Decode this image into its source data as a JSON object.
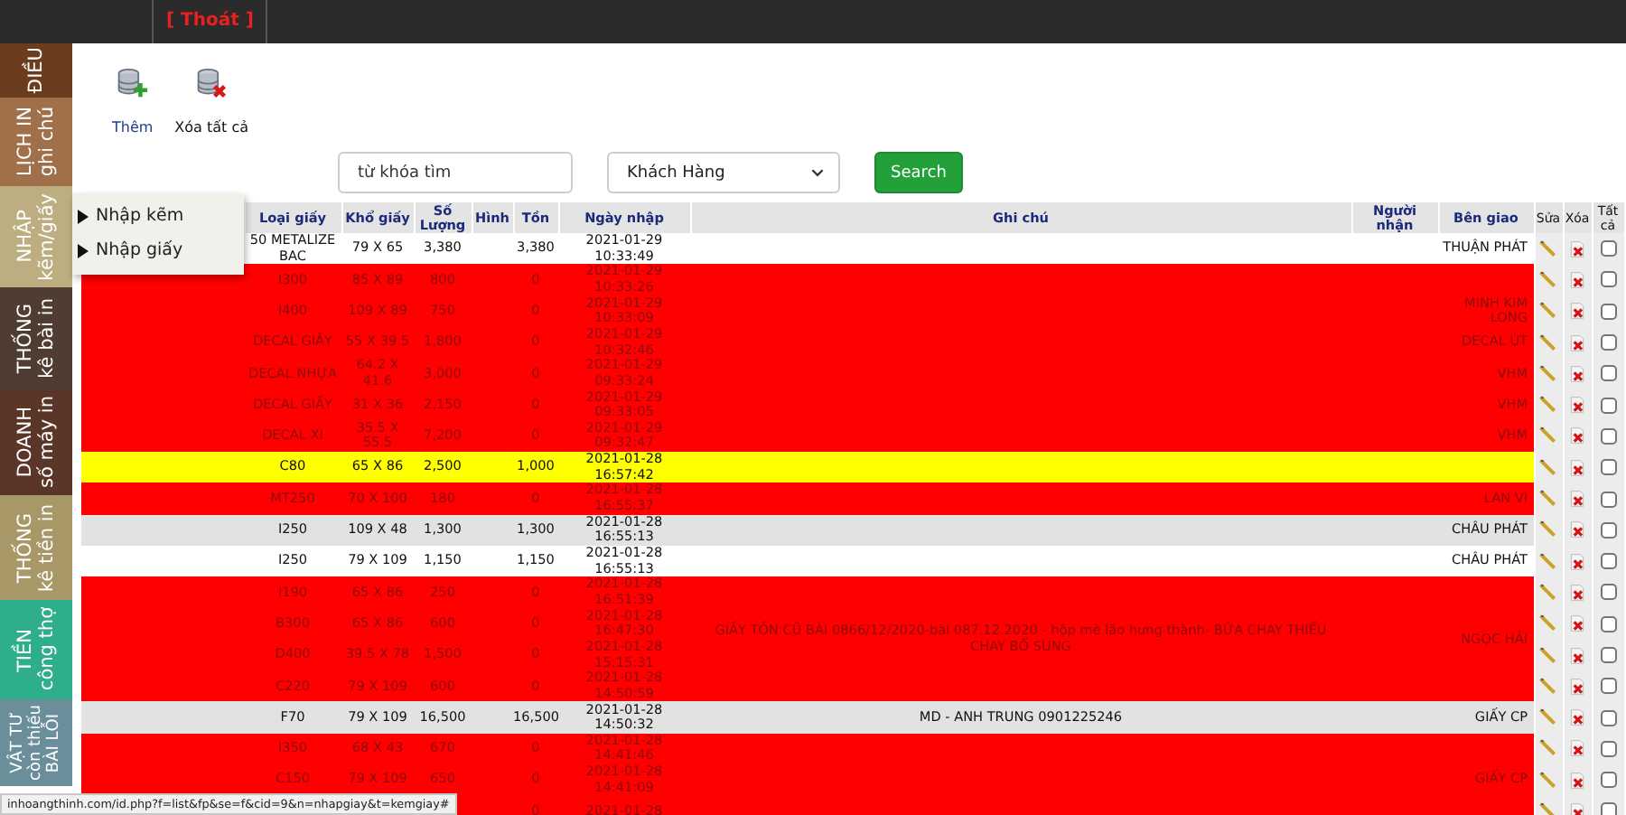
{
  "top_bar": {
    "logout": "[ Thoát ]"
  },
  "sidebar": {
    "tabs": [
      {
        "lines": [
          "ĐIỀU"
        ],
        "color": "#6b3d1e"
      },
      {
        "lines": [
          "LỊCH IN",
          "ghi chú"
        ],
        "color": "#a0704a"
      },
      {
        "lines": [
          "NHẬP",
          "kẽm/giấy"
        ],
        "color": "#bcae80"
      },
      {
        "lines": [
          "THỐNG",
          "kê bài in"
        ],
        "color": "#4f3d31"
      },
      {
        "lines": [
          "DOANH",
          "số máy in"
        ],
        "color": "#5a3628"
      },
      {
        "lines": [
          "THỐNG",
          "kê tiền in"
        ],
        "color": "#a89868"
      },
      {
        "lines": [
          "TIỀN",
          "công thợ"
        ],
        "color": "#2fae8c"
      },
      {
        "lines": [
          "VẬT TƯ",
          "còn thiếu",
          "BÀI LỖI"
        ],
        "color": "#6b8e9b"
      }
    ]
  },
  "popup_menu": {
    "items": [
      "Nhập kẽm",
      "Nhập giấy"
    ]
  },
  "toolbar": {
    "buttons": [
      {
        "label": "Thêm",
        "kind": "add"
      },
      {
        "label": "Xóa tất cả",
        "kind": "delete"
      }
    ]
  },
  "search": {
    "placeholder": "từ khóa tìm",
    "filter": "Khách Hàng",
    "button": "Search"
  },
  "table": {
    "columns": [
      "Loại giấy",
      "Khổ giấy",
      "Số Lượng",
      "Hình",
      "Tồn",
      "Ngày nhập",
      "Ghi chú",
      "Người nhận",
      "Bên giao",
      "Sửa",
      "Xóa",
      "Tất cả"
    ],
    "groups": [
      {
        "giver": "THUẬN PHÁT",
        "rows": [
          {
            "paper": "50 METALIZE BAC",
            "size": "79 X 65",
            "qty": "3,380",
            "stock": "3,380",
            "date": "2021-01-29",
            "time": "10:33:49",
            "color": "#ffffff",
            "checked": false
          }
        ]
      },
      {
        "rows": [
          {
            "paper": "I300",
            "size": "85 X 89",
            "qty": "800",
            "stock": "0",
            "date": "2021-01-29",
            "time": "10:33:26",
            "color": "#ff0000",
            "checked": false
          }
        ]
      },
      {
        "giver": "MINH KIM LONG",
        "rows": [
          {
            "paper": "I400",
            "size": "109 X 89",
            "qty": "750",
            "stock": "0",
            "date": "2021-01-29",
            "time": "10:33:09",
            "color": "#ff0000",
            "checked": false
          }
        ]
      },
      {
        "giver": "DECAL ÚT",
        "rows": [
          {
            "paper": "DECAL GIẤY",
            "size": "55 X 39.5",
            "qty": "1,800",
            "stock": "0",
            "date": "2021-01-29",
            "time": "10:32:46",
            "color": "#ff0000",
            "checked": false
          }
        ]
      },
      {
        "giver": "VHM",
        "rows": [
          {
            "paper": "DECAL NHỰA",
            "size": "64.2 X 41.6",
            "qty": "3,000",
            "stock": "0",
            "date": "2021-01-29",
            "time": "09:33:24",
            "color": "#ff0000",
            "checked": false
          }
        ]
      },
      {
        "giver": "VHM",
        "rows": [
          {
            "paper": "DECAL GIẤY",
            "size": "31 X 36",
            "qty": "2,150",
            "stock": "0",
            "date": "2021-01-29",
            "time": "09:33:05",
            "color": "#ff0000",
            "checked": false
          }
        ]
      },
      {
        "giver": "VHM",
        "rows": [
          {
            "paper": "DECAL XI",
            "size": "35.5 X 55.5",
            "qty": "7,200",
            "stock": "0",
            "date": "2021-01-29",
            "time": "09:32:47",
            "color": "#ff0000",
            "checked": false
          }
        ]
      },
      {
        "rows": [
          {
            "paper": "C80",
            "size": "65 X 86",
            "qty": "2,500",
            "stock": "1,000",
            "date": "2021-01-28",
            "time": "16:57:42",
            "color": "#ffff00",
            "checked": false
          }
        ]
      },
      {
        "giver": "LAN VI",
        "rows": [
          {
            "paper": "MT250",
            "size": "70 X 100",
            "qty": "180",
            "stock": "0",
            "date": "2021-01-28",
            "time": "16:55:37",
            "color": "#ff0000",
            "checked": false
          }
        ]
      },
      {
        "giver": "CHÂU PHÁT",
        "rows": [
          {
            "paper": "I250",
            "size": "109 X 48",
            "qty": "1,300",
            "stock": "1,300",
            "date": "2021-01-28",
            "time": "16:55:13",
            "color": "#e2e2e2",
            "checked": false
          }
        ]
      },
      {
        "giver": "CHÂU PHÁT",
        "rows": [
          {
            "paper": "I250",
            "size": "79 X 109",
            "qty": "1,150",
            "stock": "1,150",
            "date": "2021-01-28",
            "time": "16:55:13",
            "color": "#ffffff",
            "checked": false
          }
        ]
      },
      {
        "note": "GIẤY TỒN CŨ BÀI 0866/12/2020-bài 087.12.2020 - hộp mè lão hưng thành- BỮA CHAY THIẾU CHAY BỔ SUNG",
        "giver": "NGỌC HẢI",
        "rows": [
          {
            "paper": "I190",
            "size": "65 X 86",
            "qty": "250",
            "stock": "0",
            "date": "2021-01-28",
            "time": "16:51:39",
            "color": "#ff0000",
            "checked": false
          },
          {
            "paper": "B300",
            "size": "65 X 86",
            "qty": "600",
            "stock": "0",
            "date": "2021-01-28",
            "time": "16:47:30",
            "color": "#ff0000",
            "checked": false
          },
          {
            "paper": "D400",
            "size": "39.5 X 78",
            "qty": "1,500",
            "stock": "0",
            "date": "2021-01-28",
            "time": "15:15:31",
            "color": "#ff0000",
            "checked": false
          },
          {
            "paper": "C220",
            "size": "79 X 109",
            "qty": "600",
            "stock": "0",
            "date": "2021-01-28",
            "time": "14:50:59",
            "color": "#ff0000",
            "checked": false
          }
        ]
      },
      {
        "note": "MD - ANH TRUNG 0901225246",
        "giver": "GIẤY CP",
        "rows": [
          {
            "paper": "F70",
            "size": "79 X 109",
            "qty": "16,500",
            "stock": "16,500",
            "date": "2021-01-28",
            "time": "14:50:32",
            "color": "#e2e2e2",
            "checked": false
          }
        ]
      },
      {
        "rows": [
          {
            "paper": "I350",
            "size": "68 X 43",
            "qty": "670",
            "stock": "0",
            "date": "2021-01-28",
            "time": "14:41:46",
            "color": "#ff0000",
            "checked": false
          }
        ]
      },
      {
        "giver": "GIẤY CP",
        "rows": [
          {
            "paper": "C150",
            "size": "79 X 109",
            "qty": "650",
            "stock": "0",
            "date": "2021-01-28",
            "time": "14:41:09",
            "color": "#ff0000",
            "checked": false
          }
        ]
      },
      {
        "rows": [
          {
            "stock": "0",
            "date": "2021-01-28",
            "color": "#ff0000",
            "checked": false
          }
        ]
      }
    ]
  },
  "status_bar": "inhoangthinh.com/id.php?f=list&fp&se=f&cid=9&n=nhapgiay&t=kemgiay#"
}
